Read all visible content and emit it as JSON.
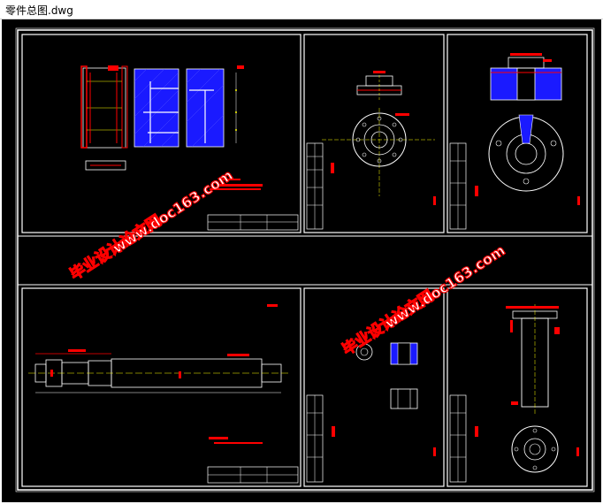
{
  "window": {
    "title": "零件总图.dwg"
  },
  "watermarks": [
    {
      "text": "毕业设计论文网"
    },
    {
      "text": "www.doc163.com"
    },
    {
      "text": "毕业设计论文网"
    },
    {
      "text": "www.doc163.com"
    },
    {
      "text": "毕业设计论文网"
    },
    {
      "text": "www.doc163.com"
    }
  ],
  "colors": {
    "background": "#000000",
    "line": "#ffffff",
    "dimension": "#ff0000",
    "hatch": "#1a1aff",
    "center": "#ffff00",
    "watermark_fill": "#ffffff",
    "watermark_stroke": "#ff0000"
  },
  "icons": [
    "drawing-canvas"
  ]
}
